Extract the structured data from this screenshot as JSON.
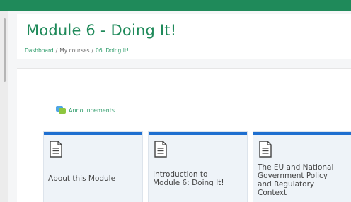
{
  "page": {
    "title": "Module 6 - Doing It!"
  },
  "breadcrumb": {
    "items": [
      "Dashboard",
      "My courses",
      "06. Doing It!"
    ],
    "separator": "/"
  },
  "announcements": {
    "label": "Announcements",
    "icon": "forum-icon"
  },
  "tiles": [
    {
      "label": "About this Module",
      "icon": "document-icon"
    },
    {
      "label": "Introduction to Module 6: Doing It!",
      "icon": "document-icon"
    },
    {
      "label": "The EU and National Government Policy and Regulatory Context",
      "icon": "document-icon"
    }
  ],
  "colors": {
    "brand": "#1f8a5a",
    "tile_accent": "#1e6fd0",
    "tile_bg": "#eef3f8"
  }
}
